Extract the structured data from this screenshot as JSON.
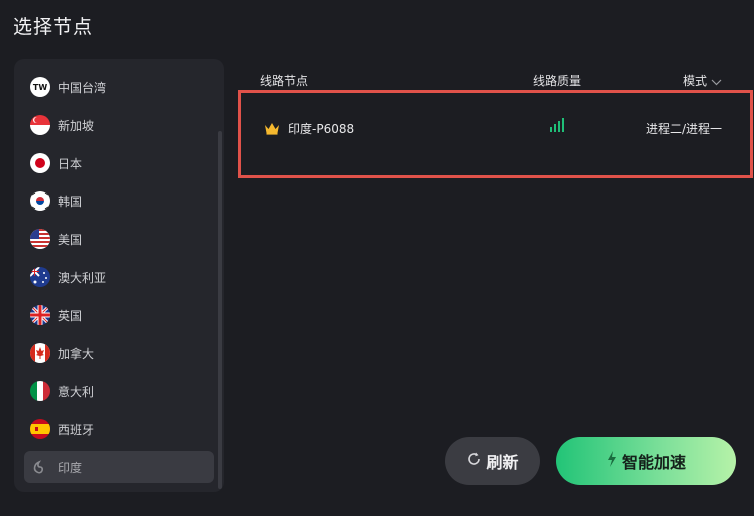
{
  "window": {
    "title": "选择节点"
  },
  "sidebar": {
    "regions": [
      {
        "label": "中国台湾",
        "icon": "tw-flag-icon"
      },
      {
        "label": "新加坡",
        "icon": "sg-flag-icon"
      },
      {
        "label": "日本",
        "icon": "jp-flag-icon"
      },
      {
        "label": "韩国",
        "icon": "kr-flag-icon"
      },
      {
        "label": "美国",
        "icon": "us-flag-icon"
      },
      {
        "label": "澳大利亚",
        "icon": "au-flag-icon"
      },
      {
        "label": "英国",
        "icon": "gb-flag-icon"
      },
      {
        "label": "加拿大",
        "icon": "ca-flag-icon"
      },
      {
        "label": "意大利",
        "icon": "it-flag-icon"
      },
      {
        "label": "西班牙",
        "icon": "es-flag-icon"
      },
      {
        "label": "印度",
        "icon": "india-icon",
        "selected": true
      }
    ],
    "tw_badge": "TW"
  },
  "table": {
    "headers": {
      "node": "线路节点",
      "quality": "线路质量",
      "mode": "模式"
    },
    "rows": [
      {
        "name": "印度-P6088",
        "mode": "进程二/进程一",
        "quality_bars": 4,
        "vip": true
      }
    ]
  },
  "buttons": {
    "refresh": "刷新",
    "boost": "智能加速"
  },
  "colors": {
    "highlight": "#e0524a",
    "signal": "#1fbf78",
    "boost_start": "#22c477",
    "boost_end": "#b6f2a8"
  }
}
